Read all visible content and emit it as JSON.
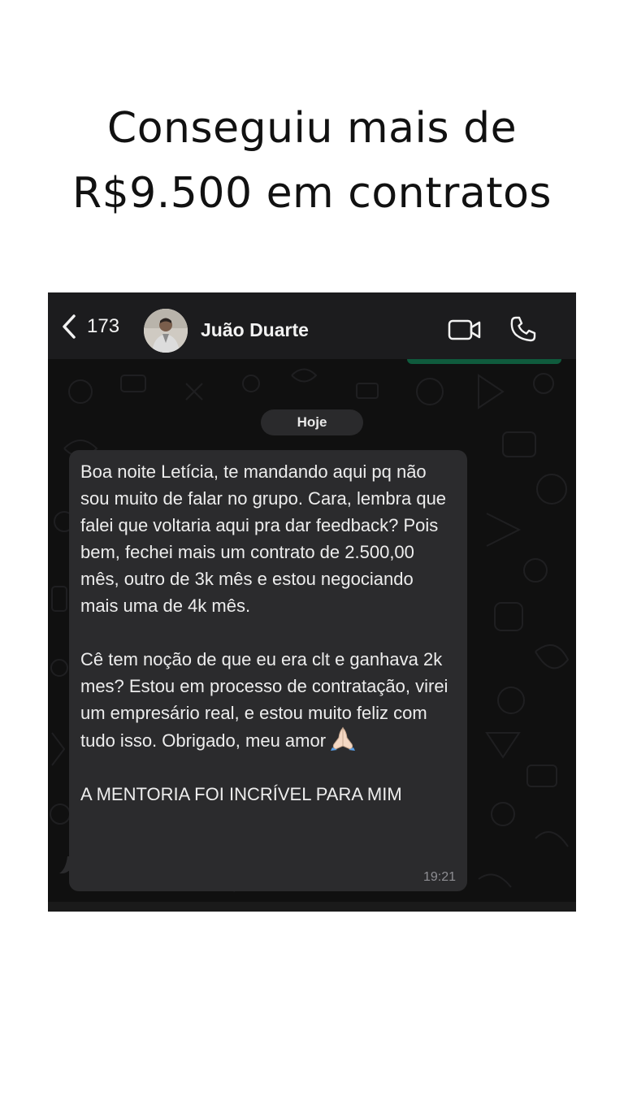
{
  "headline": {
    "line1": "Conseguiu mais de",
    "line2": "R$9.500 em contratos"
  },
  "chat": {
    "header": {
      "back_count": "173",
      "contact_name": "Juão Duarte",
      "icons": [
        "chevron-left-icon",
        "avatar",
        "video-icon",
        "phone-icon"
      ]
    },
    "date_chip": "Hoje",
    "message": {
      "para1": "Boa noite Letícia, te mandando aqui pq não sou muito de falar no grupo. Cara, lembra que falei que voltaria aqui pra dar feedback? Pois bem, fechei mais um contrato de 2.500,00 mês, outro de 3k mês e estou negociando mais uma de 4k mês.",
      "para2": "Cê tem noção de que eu era clt e ganhava 2k mes? Estou em processo de contratação, virei um empresário real, e estou muito feliz com tudo isso. Obrigado, meu amor",
      "emoji": "praying-hands",
      "para3": "A MENTORIA FOI INCRÍVEL PARA MIM",
      "time": "19:21"
    },
    "colors": {
      "header_bg": "#1c1c1e",
      "chat_bg": "#101010",
      "bubble_bg": "#2b2b2d",
      "accent_green": "#0f5b3d"
    }
  }
}
